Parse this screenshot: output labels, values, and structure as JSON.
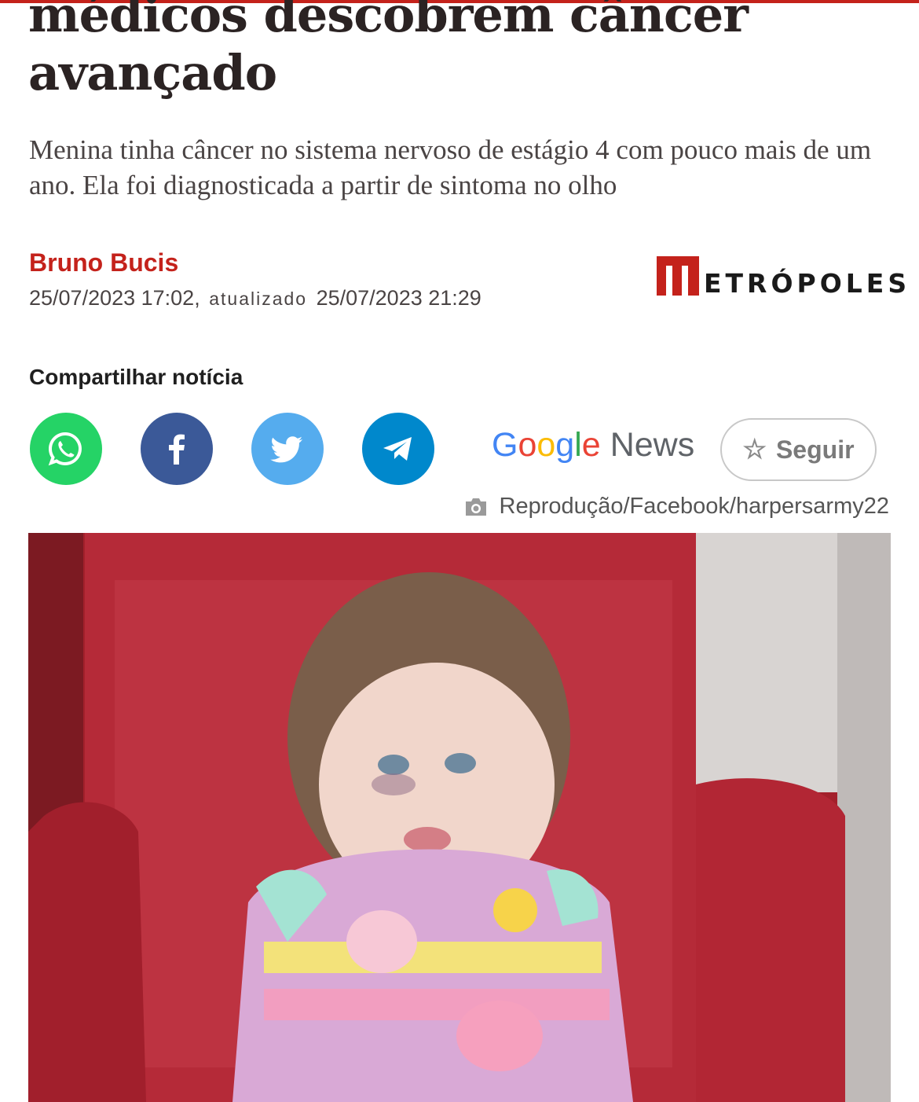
{
  "article": {
    "headline_line1": "médicos descobrem câncer",
    "headline_line2": "avançado",
    "subtitle": "Menina tinha câncer no sistema nervoso de estágio 4 com pouco mais de um ano. Ela foi diagnosticada a partir de sintoma no olho",
    "author": "Bruno Bucis",
    "published": "25/07/2023 17:02,",
    "updated_label": "atualizado",
    "updated": "25/07/2023 21:29"
  },
  "brand": {
    "logo_text": "ETRÓPOLES",
    "accent_color": "#c4221b"
  },
  "share": {
    "label": "Compartilhar notícia",
    "buttons": [
      {
        "name": "whatsapp",
        "color": "#25d366"
      },
      {
        "name": "facebook",
        "color": "#3b5998"
      },
      {
        "name": "twitter",
        "color": "#55acee"
      },
      {
        "name": "telegram",
        "color": "#0088cc"
      }
    ],
    "google_news": {
      "google": "Google",
      "news": "News",
      "follow_label": "Seguir"
    }
  },
  "photo": {
    "credit": "Reprodução/Facebook/harpersarmy22",
    "content": "toddler-in-red-armchair"
  }
}
